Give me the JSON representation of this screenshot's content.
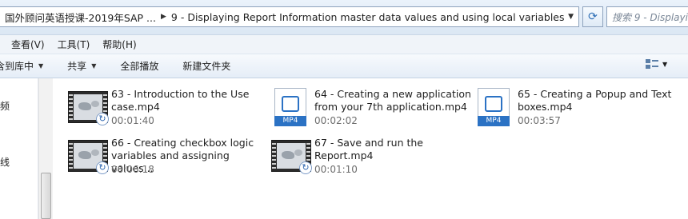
{
  "address_bar": {
    "breadcrumbs": [
      "国外顾问英语授课-2019年SAP ...",
      "9 - Displaying Report Information master data values and using local variables"
    ],
    "search_placeholder": "搜索 9 - Displayin"
  },
  "menu": [
    "查看(V)",
    "工具(T)",
    "帮助(H)"
  ],
  "command_bar": {
    "items": [
      {
        "label": "含到库中",
        "has_dropdown": true
      },
      {
        "label": "共享",
        "has_dropdown": true
      },
      {
        "label": "全部播放",
        "has_dropdown": false
      },
      {
        "label": "新建文件夹",
        "has_dropdown": false
      }
    ]
  },
  "nav_fragments": [
    "频",
    "线",
    ""
  ],
  "files": [
    {
      "name": "63 - Introduction to the Use case.mp4",
      "duration": "00:01:40",
      "thumb": "video-film-icon"
    },
    {
      "name": "64 - Creating a new application from your 7th application.mp4",
      "duration": "00:02:02",
      "thumb": "mp4-file-icon",
      "thumb_label": "MP4"
    },
    {
      "name": "65 - Creating a Popup and Text boxes.mp4",
      "duration": "00:03:57",
      "thumb": "mp4-file-icon",
      "thumb_label": "MP4"
    },
    {
      "name": "66 - Creating checkbox logic variables and assigning values...",
      "duration": "00:06:18",
      "thumb": "video-film-icon"
    },
    {
      "name": "67 - Save and run the Report.mp4",
      "duration": "00:01:10",
      "thumb": "video-film-icon"
    }
  ],
  "colors": {
    "accent": "#2b72c4",
    "duration_text": "#6d6d6d"
  }
}
